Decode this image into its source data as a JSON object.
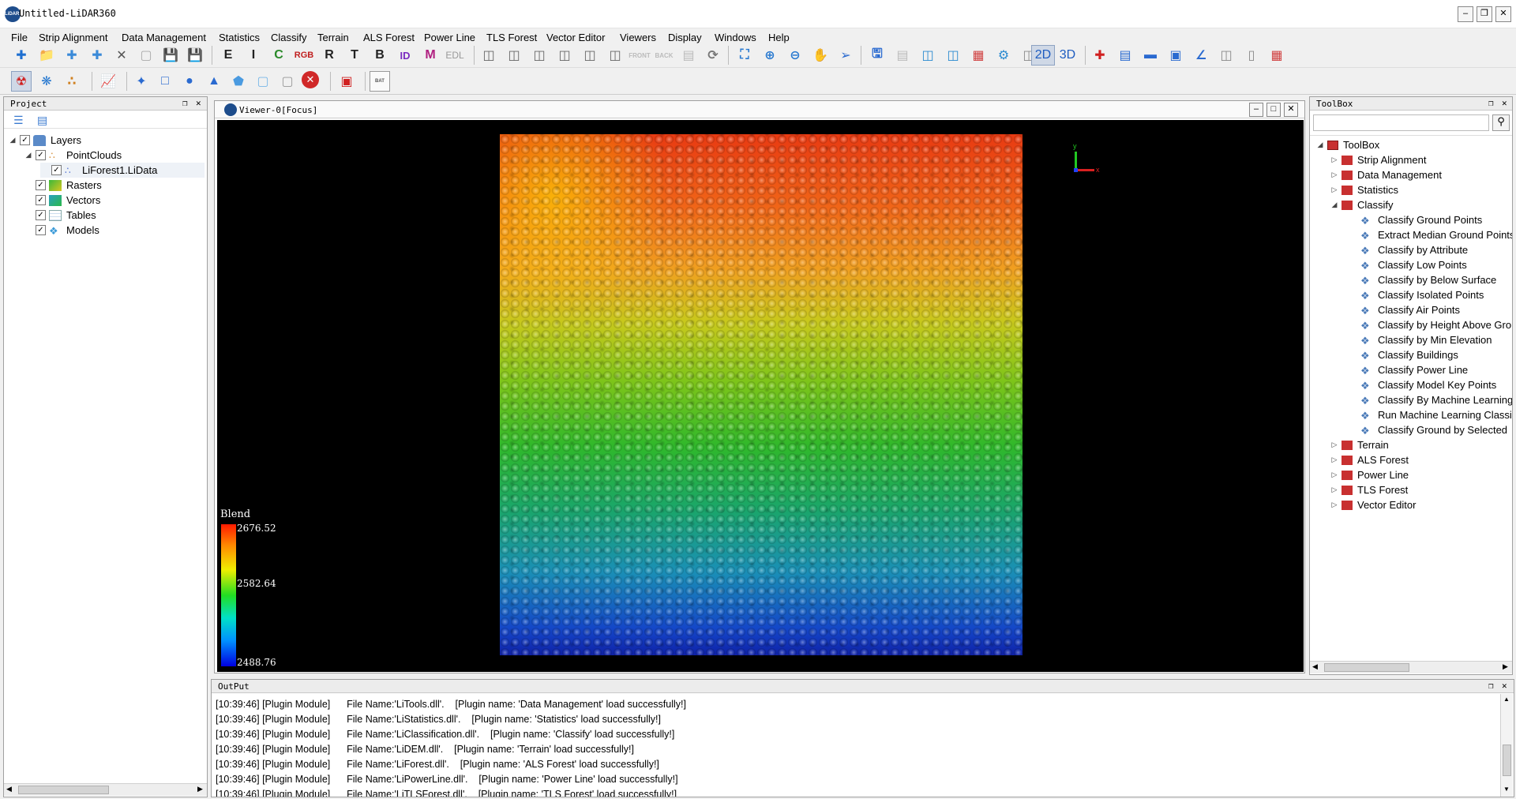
{
  "window": {
    "title": "Untitled-LiDAR360",
    "logo_text": "LiDAR360"
  },
  "menu": [
    "File",
    "Strip Alignment",
    "Data Management",
    "Statistics",
    "Classify",
    "Terrain",
    "ALS Forest",
    "Power Line",
    "TLS Forest",
    "Vector Editor",
    "Viewers",
    "Display",
    "Windows",
    "Help"
  ],
  "toolbar": {
    "letters": [
      "E",
      "I",
      "C",
      "R",
      "T",
      "B",
      "ID",
      "M",
      "EDL"
    ],
    "mode_2d": "2D",
    "mode_3d": "3D",
    "bat_label": "BAT"
  },
  "project": {
    "header": "Project",
    "tree": [
      {
        "label": "Layers",
        "checked": true
      },
      {
        "label": "PointClouds",
        "checked": true
      },
      {
        "label": "LiForest1.LiData",
        "checked": true
      },
      {
        "label": "Rasters",
        "checked": true
      },
      {
        "label": "Vectors",
        "checked": true
      },
      {
        "label": "Tables",
        "checked": true
      },
      {
        "label": "Models",
        "checked": true
      }
    ]
  },
  "viewer": {
    "title": "Viewer-0[Focus]",
    "legend": {
      "title": "Blend",
      "max": "2676.52",
      "mid": "2582.64",
      "min": "2488.76"
    },
    "axes": {
      "y": "y",
      "x": "x"
    }
  },
  "toolbox": {
    "header": "ToolBox",
    "search_placeholder": "",
    "root": "ToolBox",
    "categories": [
      "Strip Alignment",
      "Data Management",
      "Statistics",
      "Classify"
    ],
    "classify_tools": [
      "Classify Ground Points",
      "Extract Median Ground Points",
      "Classify by Attribute",
      "Classify Low Points",
      "Classify by Below Surface",
      "Classify Isolated Points",
      "Classify Air Points",
      "Classify by Height Above Ground",
      "Classify by Min Elevation",
      "Classify Buildings",
      "Classify Power Line",
      "Classify Model Key Points",
      "Classify By Machine Learning",
      "Run Machine Learning Classification",
      "Classify Ground by Selected"
    ],
    "more_categories": [
      "Terrain",
      "ALS Forest",
      "Power Line",
      "TLS Forest",
      "Vector Editor"
    ]
  },
  "output": {
    "header": "OutPut",
    "lines": [
      "[10:39:46] [Plugin Module]      File Name:'LiTools.dll'.    [Plugin name: 'Data Management' load successfully!]",
      "[10:39:46] [Plugin Module]      File Name:'LiStatistics.dll'.    [Plugin name: 'Statistics' load successfully!]",
      "[10:39:46] [Plugin Module]      File Name:'LiClassification.dll'.    [Plugin name: 'Classify' load successfully!]",
      "[10:39:46] [Plugin Module]      File Name:'LiDEM.dll'.    [Plugin name: 'Terrain' load successfully!]",
      "[10:39:46] [Plugin Module]      File Name:'LiForest.dll'.    [Plugin name: 'ALS Forest' load successfully!]",
      "[10:39:46] [Plugin Module]      File Name:'LiPowerLine.dll'.    [Plugin name: 'Power Line' load successfully!]",
      "[10:39:46] [Plugin Module]      File Name:'LiTLSForest.dll'.    [Plugin name: 'TLS Forest' load successfully!]"
    ]
  },
  "colors": {
    "accent": "#1e4d8c",
    "selection": "#cfd8e6"
  }
}
